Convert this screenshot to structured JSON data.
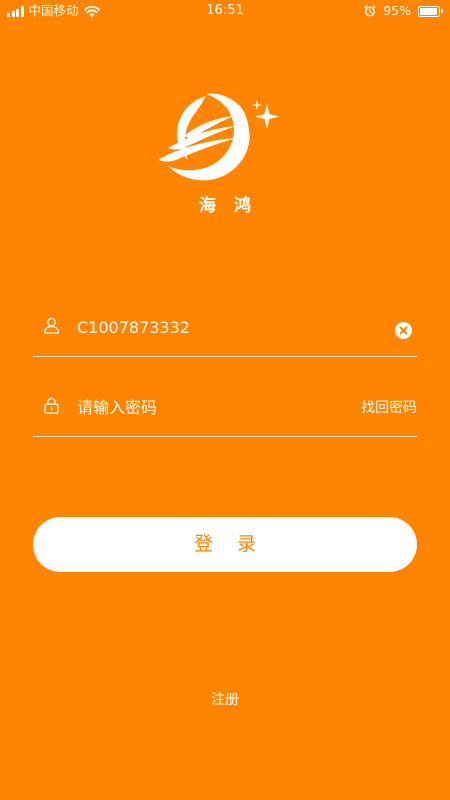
{
  "status_bar": {
    "carrier": "中国移动",
    "time": "16:51",
    "battery_percent": "95%",
    "battery_level": 0.95,
    "icons": [
      "signal-icon",
      "wifi-icon",
      "alarm-icon",
      "battery-icon"
    ]
  },
  "brand": {
    "name": "海 鸿",
    "logo_icon": "crescent-bird-star-logo"
  },
  "login_form": {
    "username": {
      "value": "C1007873332",
      "icon": "user-icon",
      "clear_icon": "clear-icon"
    },
    "password": {
      "value": "",
      "placeholder": "请输入密码",
      "icon": "lock-icon",
      "forgot_label": "找回密码"
    },
    "submit_label": "登 录"
  },
  "register_label": "注册",
  "colors": {
    "background": "#ff8400",
    "foreground": "#ffffff",
    "button_text": "#ff8400"
  }
}
